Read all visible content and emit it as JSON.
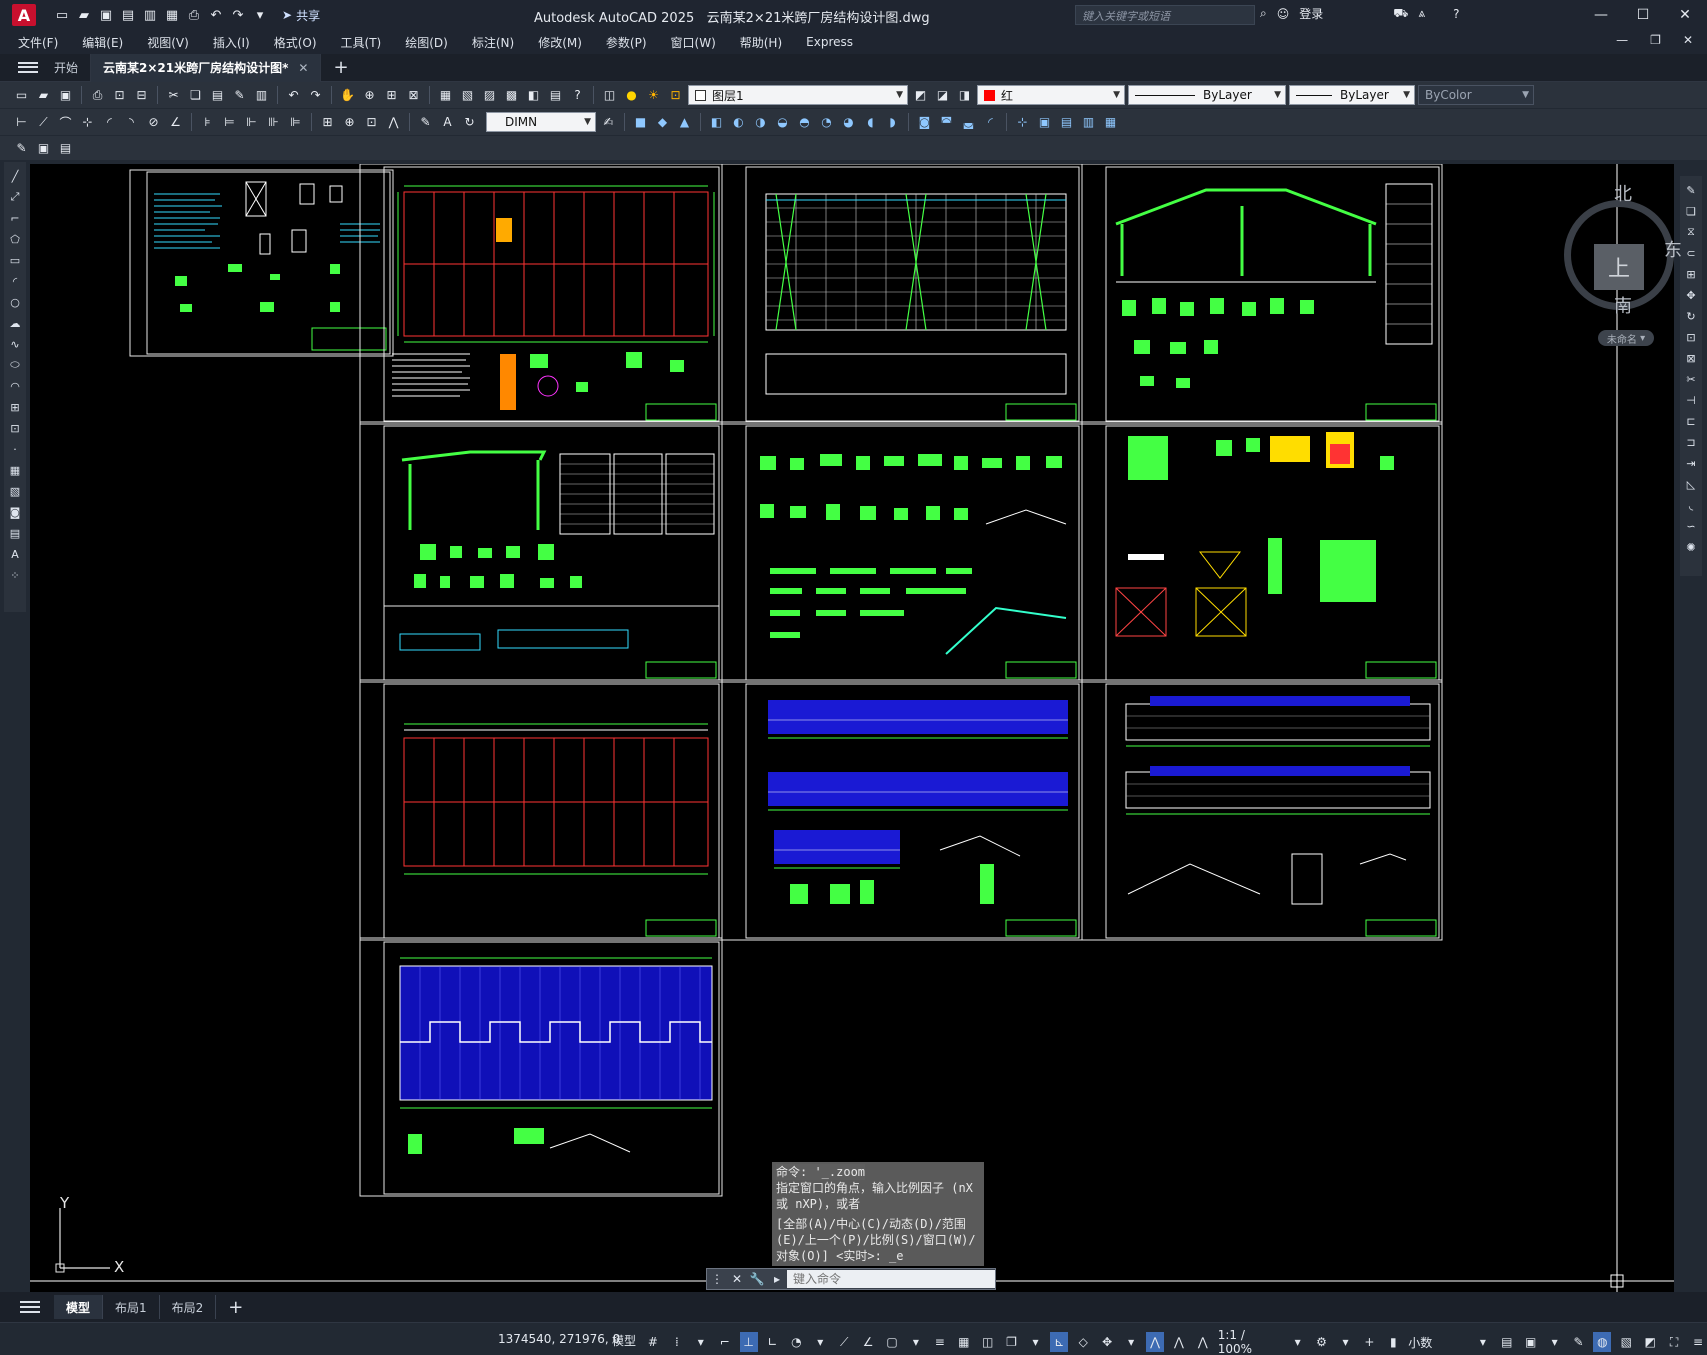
{
  "app": {
    "title": "Autodesk AutoCAD 2025",
    "file_name": "云南某2×21米跨厂房结构设计图.dwg",
    "logo_letter": "A",
    "share_label": "共享",
    "search_placeholder": "键入关键字或短语",
    "login_label": "登录"
  },
  "menu": [
    "文件(F)",
    "编辑(E)",
    "视图(V)",
    "插入(I)",
    "格式(O)",
    "工具(T)",
    "绘图(D)",
    "标注(N)",
    "修改(M)",
    "参数(P)",
    "窗口(W)",
    "帮助(H)",
    "Express"
  ],
  "doc_tabs": {
    "start": "开始",
    "active": "云南某2×21米跨厂房结构设计图*"
  },
  "properties": {
    "layer": "图层1",
    "color": "红",
    "color_hex": "#ff0000",
    "linetype": "ByLayer",
    "lineweight": "ByLayer",
    "plotstyle": "ByColor",
    "dimstyle": "DIMN"
  },
  "viewcube": {
    "north": "北",
    "east": "东",
    "south": "南",
    "top": "上",
    "name": "未命名"
  },
  "ucs": {
    "x": "X",
    "y": "Y"
  },
  "command": {
    "history": [
      "命令: '_.zoom",
      "指定窗口的角点，输入比例因子 (nX",
      "或 nXP)，或者",
      "[全部(A)/中心(C)/动态(D)/范围",
      "(E)/上一个(P)/比例(S)/窗口(W)/",
      "对象(O)] <实时>: _e"
    ],
    "placeholder": "键入命令"
  },
  "layout_tabs": [
    "模型",
    "布局1",
    "布局2"
  ],
  "status": {
    "coords": "1374540, 271976, 0",
    "space": "模型",
    "scale": "1:1 / 100%",
    "units": "小数"
  }
}
